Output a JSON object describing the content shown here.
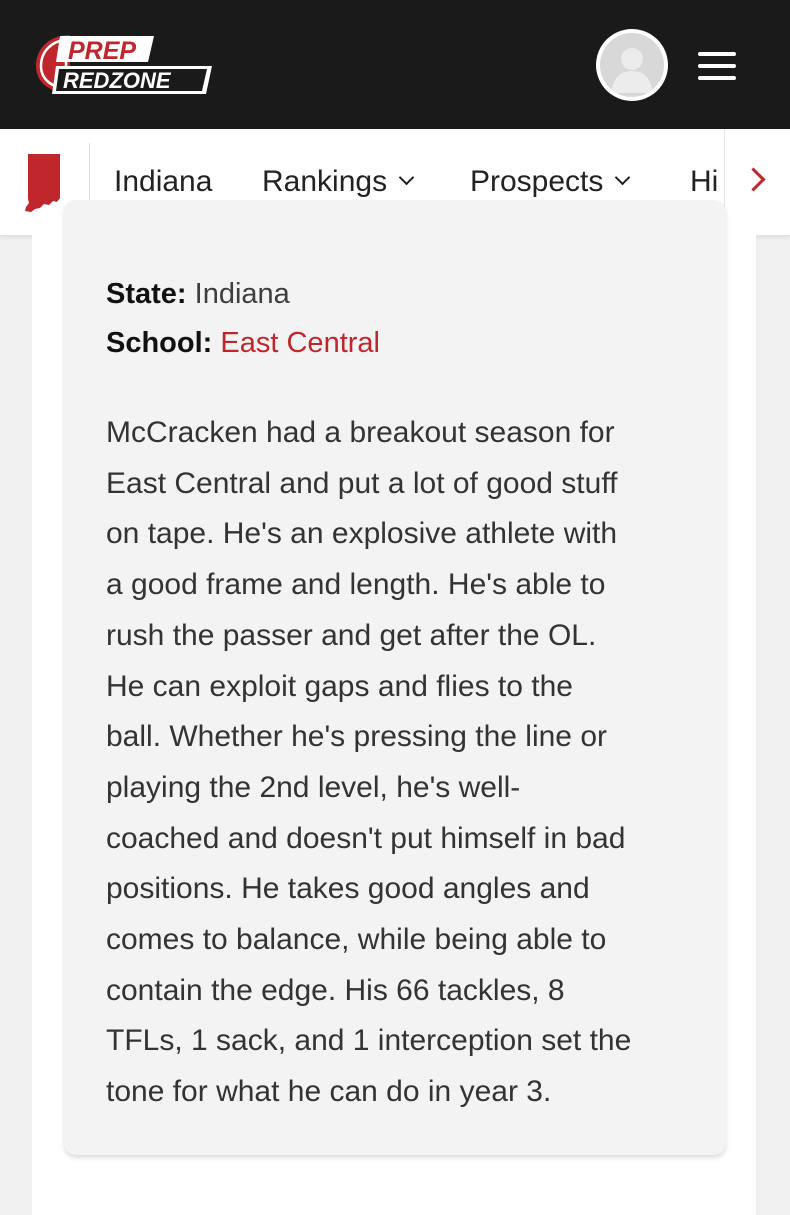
{
  "header": {
    "logo": {
      "line1": "PREP",
      "line2": "REDZONE"
    },
    "colors": {
      "header_bg": "#1a1a1a",
      "brand_red": "#c0272d"
    },
    "avatar_icon": "user-avatar-icon",
    "menu_icon": "hamburger-menu-icon"
  },
  "subnav": {
    "state_icon": "indiana-state-icon",
    "items": [
      {
        "label": "Indiana",
        "has_dropdown": false
      },
      {
        "label": "Rankings",
        "has_dropdown": true
      },
      {
        "label": "Prospects",
        "has_dropdown": true
      },
      {
        "label": "Hi",
        "has_dropdown": false
      }
    ],
    "scroll_icon": "chevron-right-icon"
  },
  "profile": {
    "state_label": "State:",
    "state_value": "Indiana",
    "school_label": "School:",
    "school_value": "East Central",
    "bio_lines": [
      "McCracken had a breakout season for",
      "East Central and put a lot of good stuff",
      "on tape. He's an explosive athlete with",
      "a good frame and length. He's able to",
      "rush the passer and get after the OL.",
      "He can exploit gaps and flies to the",
      "ball. Whether he's pressing the line or",
      "playing the 2nd level, he's well-",
      "coached and doesn't put himself in bad",
      "positions. He takes good angles and",
      "comes to balance, while being able to",
      "contain the edge. His 66 tackles, 8",
      "TFLs, 1 sack, and 1 interception set the",
      "tone for what he can do in year 3."
    ]
  }
}
